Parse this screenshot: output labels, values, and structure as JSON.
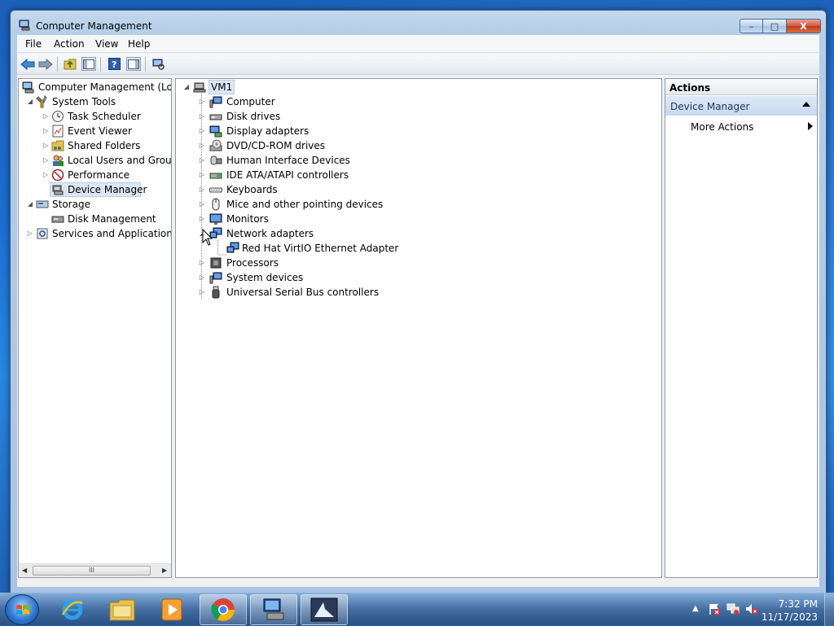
{
  "window": {
    "title": "Computer Management",
    "controls": {
      "minimize": "–",
      "maximize": "□",
      "close": "X"
    }
  },
  "menu": [
    "File",
    "Action",
    "View",
    "Help"
  ],
  "toolbar": [
    "back-icon",
    "forward-icon",
    "up-folder-icon",
    "show-hide-console-tree-icon",
    "help-icon",
    "show-hide-action-pane-icon",
    "scan-hardware-icon"
  ],
  "left_tree": {
    "root": "Computer Management (Local",
    "items": [
      {
        "label": "System Tools",
        "icon": "tools-icon"
      },
      {
        "label": "Task Scheduler",
        "icon": "clock-icon"
      },
      {
        "label": "Event Viewer",
        "icon": "event-viewer-icon"
      },
      {
        "label": "Shared Folders",
        "icon": "shared-folder-icon"
      },
      {
        "label": "Local Users and Groups",
        "icon": "users-icon"
      },
      {
        "label": "Performance",
        "icon": "performance-icon"
      },
      {
        "label": "Device Manager",
        "icon": "device-manager-icon",
        "selected": true
      },
      {
        "label": "Storage",
        "icon": "storage-icon"
      },
      {
        "label": "Disk Management",
        "icon": "disk-icon"
      },
      {
        "label": "Services and Applications",
        "icon": "services-icon"
      }
    ],
    "scroll_thumb": "III"
  },
  "device_tree": {
    "root": "VM1",
    "categories": [
      {
        "label": "Computer",
        "icon": "computer-icon"
      },
      {
        "label": "Disk drives",
        "icon": "disk-drive-icon"
      },
      {
        "label": "Display adapters",
        "icon": "display-adapter-icon"
      },
      {
        "label": "DVD/CD-ROM drives",
        "icon": "dvd-icon"
      },
      {
        "label": "Human Interface Devices",
        "icon": "hid-icon"
      },
      {
        "label": "IDE ATA/ATAPI controllers",
        "icon": "ide-icon"
      },
      {
        "label": "Keyboards",
        "icon": "keyboard-icon"
      },
      {
        "label": "Mice and other pointing devices",
        "icon": "mouse-icon"
      },
      {
        "label": "Monitors",
        "icon": "monitor-icon"
      },
      {
        "label": "Network adapters",
        "icon": "network-adapter-icon",
        "expanded": true
      },
      {
        "label": "Red Hat VirtIO Ethernet Adapter",
        "icon": "network-adapter-icon",
        "child": true
      },
      {
        "label": "Processors",
        "icon": "processor-icon"
      },
      {
        "label": "System devices",
        "icon": "system-devices-icon"
      },
      {
        "label": "Universal Serial Bus controllers",
        "icon": "usb-icon"
      }
    ]
  },
  "actions": {
    "header": "Actions",
    "section": "Device Manager",
    "items": [
      "More Actions"
    ]
  },
  "taskbar": {
    "apps": [
      "internet-explorer-icon",
      "explorer-folder-icon",
      "media-player-icon",
      "chrome-icon",
      "computer-management-icon",
      "app-icon"
    ],
    "time": "7:32 PM",
    "date": "11/17/2023"
  },
  "colors": {
    "selection": "#dce7f5",
    "actions_section": "#c7d8ee",
    "title_gradient": "#b5cde8"
  }
}
